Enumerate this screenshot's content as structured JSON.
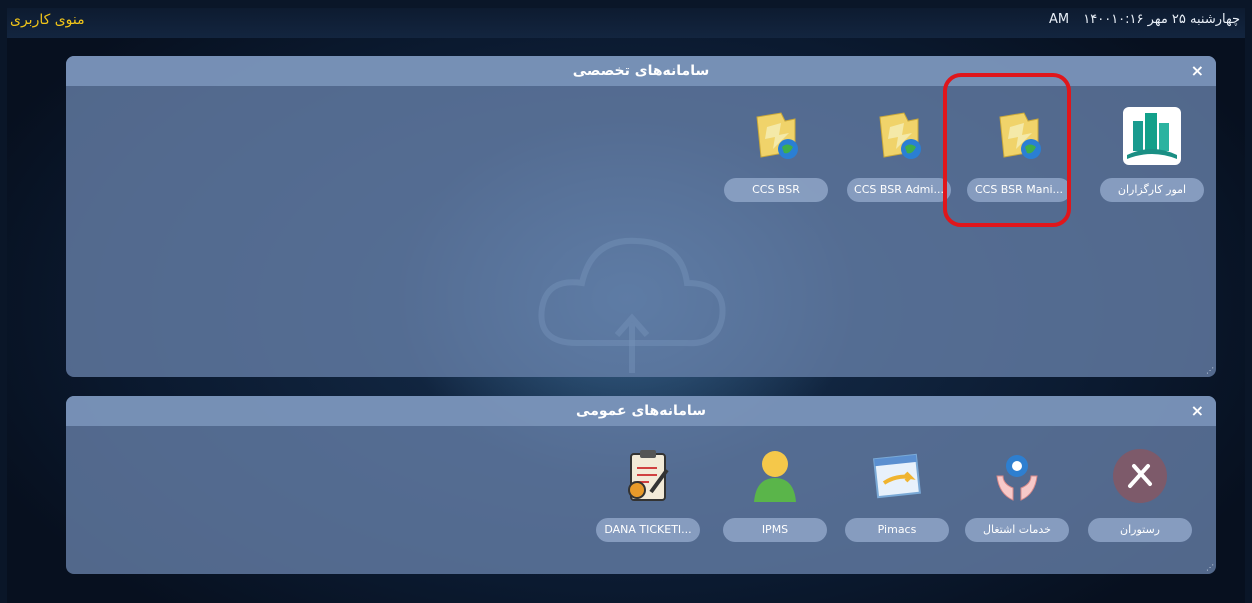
{
  "topbar": {
    "user_menu": "منوی کاربری",
    "date": "چهارشنبه ۲۵ مهر ۱۴۰۰",
    "time": "۱۰:۱۶ AM"
  },
  "specialized": {
    "title": "سامانه‌های تخصصی",
    "close": "×",
    "tiles": [
      {
        "label": "امور کارگزاران",
        "icon": "buildings-icon"
      },
      {
        "label": "CCS BSR Mani...",
        "icon": "folder-globe-icon"
      },
      {
        "label": "CCS BSR Admi...",
        "icon": "folder-globe-icon"
      },
      {
        "label": "CCS BSR",
        "icon": "folder-globe-icon"
      }
    ]
  },
  "general": {
    "title": "سامانه‌های عمومی",
    "close": "×",
    "tiles": [
      {
        "label": "رستوران",
        "icon": "fork-knife-icon"
      },
      {
        "label": "خدمات اشتغال",
        "icon": "hands-gear-icon"
      },
      {
        "label": "Pimacs",
        "icon": "window-arrow-icon"
      },
      {
        "label": "IPMS",
        "icon": "user-icon"
      },
      {
        "label": "DANA TICKETI...",
        "icon": "clipboard-gear-icon"
      }
    ]
  },
  "colors": {
    "highlight": "#e0161b",
    "user_menu": "#f0c419"
  }
}
